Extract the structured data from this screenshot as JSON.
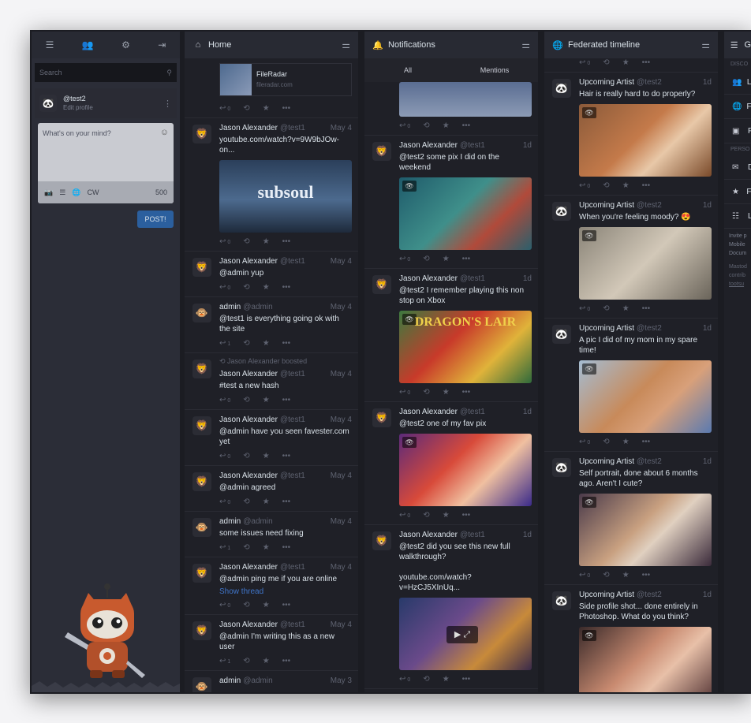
{
  "compose_column": {
    "nav_icons": [
      "menu-icon",
      "people-icon",
      "gear-icon",
      "logout-icon"
    ],
    "nav_glyphs": [
      "☰",
      "👥",
      "⚙",
      "⇥"
    ],
    "search_placeholder": "Search",
    "account": {
      "handle": "@test2",
      "edit_label": "Edit profile"
    },
    "compose": {
      "placeholder": "What's on your mind?",
      "cw_label": "CW",
      "char_count": "500"
    },
    "post_label": "POST!"
  },
  "home": {
    "title": "Home",
    "card": {
      "title": "FileRadar",
      "domain": "fileradar.com"
    },
    "statuses": [
      {
        "name": "Jason Alexander",
        "handle": "@test1",
        "time": "May 4",
        "text": "youtube.com/watch?v=9W9bJOw-on...",
        "replies": "0",
        "media": "subsoul",
        "media_text": "subsoul"
      },
      {
        "name": "Jason Alexander",
        "handle": "@test1",
        "time": "May 4",
        "text": "@admin yup",
        "replies": "0"
      },
      {
        "name": "admin",
        "handle": "@admin",
        "time": "May 4",
        "text": "@test1 is everything going ok with the site",
        "replies": "1"
      },
      {
        "boost": "Jason Alexander boosted",
        "name": "Jason Alexander",
        "handle": "@test1",
        "time": "May 4",
        "text": "#test a new hash",
        "replies": "0"
      },
      {
        "name": "Jason Alexander",
        "handle": "@test1",
        "time": "May 4",
        "text": "@admin have you seen favester.com yet",
        "replies": "0"
      },
      {
        "name": "Jason Alexander",
        "handle": "@test1",
        "time": "May 4",
        "text": "@admin agreed",
        "replies": "0"
      },
      {
        "name": "admin",
        "handle": "@admin",
        "time": "May 4",
        "text": "some issues need fixing",
        "replies": "1"
      },
      {
        "name": "Jason Alexander",
        "handle": "@test1",
        "time": "May 4",
        "text": "@admin ping me if you are online",
        "link": "Show thread",
        "replies": "0"
      },
      {
        "name": "Jason Alexander",
        "handle": "@test1",
        "time": "May 4",
        "text": "@admin I'm writing this as a new user",
        "replies": "1"
      },
      {
        "name": "admin",
        "handle": "@admin",
        "time": "May 3",
        "text": "",
        "replies": ""
      }
    ]
  },
  "notifications": {
    "title": "Notifications",
    "tabs": [
      "All",
      "Mentions"
    ],
    "statuses": [
      {
        "name": "Jason Alexander",
        "handle": "@test1",
        "time": "1d",
        "text": "@test2 some pix I did on the weekend",
        "replies": "0",
        "media": "mermaid"
      },
      {
        "name": "Jason Alexander",
        "handle": "@test1",
        "time": "1d",
        "text": "@test2 I remember playing this non stop on Xbox",
        "replies": "0",
        "media": "dragon",
        "media_text": "DRAGON'S LAIR"
      },
      {
        "name": "Jason Alexander",
        "handle": "@test1",
        "time": "1d",
        "text": "@test2 one of my fav pix",
        "replies": "0",
        "media": "ariel"
      },
      {
        "name": "Jason Alexander",
        "handle": "@test1",
        "time": "1d",
        "text": "@test2 did you see this new full walkthrough?\n\nyoutube.com/watch?v=HzCJ5XInUq...",
        "replies": "0",
        "media": "video"
      }
    ]
  },
  "federated": {
    "title": "Federated timeline",
    "statuses": [
      {
        "name": "Upcoming Artist",
        "handle": "@test2",
        "time": "1d",
        "text": "Hair is really hard to do properly?",
        "replies": "0",
        "media": "hair"
      },
      {
        "name": "Upcoming Artist",
        "handle": "@test2",
        "time": "1d",
        "text": "When you're feeling moody? 😍",
        "replies": "0",
        "media": "moody"
      },
      {
        "name": "Upcoming Artist",
        "handle": "@test2",
        "time": "1d",
        "text": "A pic I did of my mom in my spare time!",
        "replies": "0",
        "media": "mom"
      },
      {
        "name": "Upcoming Artist",
        "handle": "@test2",
        "time": "1d",
        "text": "Self portrait, done about 6 months ago. Aren't I cute?",
        "replies": "0",
        "media": "portrait"
      },
      {
        "name": "Upcoming Artist",
        "handle": "@test2",
        "time": "1d",
        "text": "Side profile shot... done entirely in Photoshop. What do you think?",
        "replies": "",
        "media": "profile"
      }
    ]
  },
  "getting_started": {
    "title": "G",
    "label_discover": "DISCO",
    "items": [
      "Lo",
      "Fe",
      "Pr"
    ],
    "label_personal": "PERSO",
    "items2": [
      "D",
      "Fa",
      "Li"
    ],
    "footer": [
      "Invite p",
      "Mobile",
      "Docum"
    ],
    "footer2": [
      "Mastod",
      "contrib",
      "tootsu"
    ]
  }
}
